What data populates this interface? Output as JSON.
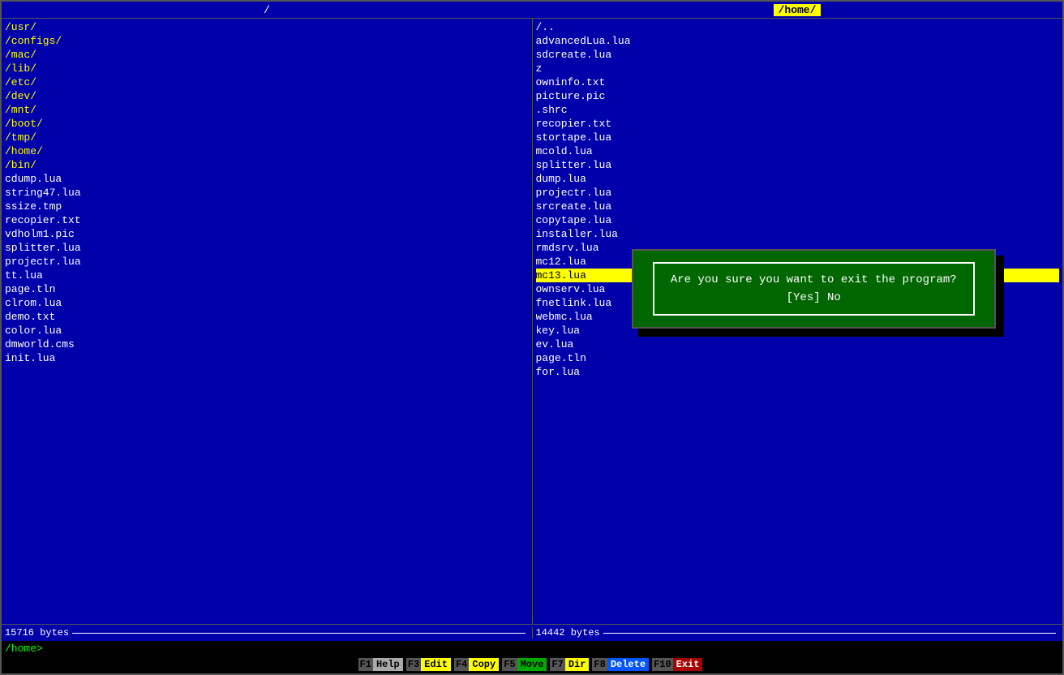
{
  "topbar": {
    "left_path": "/",
    "right_path": "/home/"
  },
  "left_panel": {
    "files": [
      {
        "name": "/usr/",
        "type": "directory"
      },
      {
        "name": "/configs/",
        "type": "directory"
      },
      {
        "name": "/mac/",
        "type": "directory"
      },
      {
        "name": "/lib/",
        "type": "directory"
      },
      {
        "name": "/etc/",
        "type": "directory"
      },
      {
        "name": "/dev/",
        "type": "directory"
      },
      {
        "name": "/mnt/",
        "type": "directory"
      },
      {
        "name": "/boot/",
        "type": "directory"
      },
      {
        "name": "/tmp/",
        "type": "directory"
      },
      {
        "name": "/home/",
        "type": "directory"
      },
      {
        "name": "/bin/",
        "type": "directory"
      },
      {
        "name": "cdump.lua",
        "type": "file"
      },
      {
        "name": "string47.lua",
        "type": "file"
      },
      {
        "name": "ssize.tmp",
        "type": "file"
      },
      {
        "name": "recopier.txt",
        "type": "file"
      },
      {
        "name": "vdholm1.pic",
        "type": "file"
      },
      {
        "name": "splitter.lua",
        "type": "file"
      },
      {
        "name": "projectr.lua",
        "type": "file"
      },
      {
        "name": "tt.lua",
        "type": "file"
      },
      {
        "name": "page.tln",
        "type": "file"
      },
      {
        "name": "clrom.lua",
        "type": "file"
      },
      {
        "name": "demo.txt",
        "type": "file"
      },
      {
        "name": "color.lua",
        "type": "file"
      },
      {
        "name": "dmworld.cms",
        "type": "file"
      },
      {
        "name": "init.lua",
        "type": "file"
      }
    ],
    "status": "15716 bytes",
    "path": "/home"
  },
  "right_panel": {
    "files": [
      {
        "name": "/..",
        "type": "file"
      },
      {
        "name": "advancedLua.lua",
        "type": "file"
      },
      {
        "name": "sdcreate.lua",
        "type": "file"
      },
      {
        "name": "z",
        "type": "file"
      },
      {
        "name": "owninfo.txt",
        "type": "file"
      },
      {
        "name": "picture.pic",
        "type": "file"
      },
      {
        "name": ".shrc",
        "type": "file"
      },
      {
        "name": "recopier.txt",
        "type": "file"
      },
      {
        "name": "stortape.lua",
        "type": "file"
      },
      {
        "name": "mcold.lua",
        "type": "file"
      },
      {
        "name": "splitter.lua",
        "type": "file"
      },
      {
        "name": "dump.lua",
        "type": "file"
      },
      {
        "name": "projectr.lua",
        "type": "file"
      },
      {
        "name": "srcreate.lua",
        "type": "file"
      },
      {
        "name": "copytape.lua",
        "type": "file"
      },
      {
        "name": "installer.lua",
        "type": "file"
      },
      {
        "name": "rmdsrv.lua",
        "type": "file"
      },
      {
        "name": "mc12.lua",
        "type": "file"
      },
      {
        "name": "mc13.lua",
        "type": "file",
        "selected": true
      },
      {
        "name": "ownserv.lua",
        "type": "file"
      },
      {
        "name": "fnetlink.lua",
        "type": "file"
      },
      {
        "name": "webmc.lua",
        "type": "file"
      },
      {
        "name": "",
        "type": "blank"
      },
      {
        "name": "key.lua",
        "type": "file"
      },
      {
        "name": "ev.lua",
        "type": "file"
      },
      {
        "name": "page.tln",
        "type": "file"
      },
      {
        "name": "for.lua",
        "type": "file"
      }
    ],
    "status": "14442 bytes"
  },
  "dialog": {
    "message": "Are you sure you want to exit the program?",
    "options": "[Yes] No"
  },
  "path_bar": {
    "text": "/home>"
  },
  "fn_keys": [
    {
      "num": "F1",
      "label": "Help",
      "color": "gray"
    },
    {
      "num": "F3",
      "label": "Edit",
      "color": "yellow"
    },
    {
      "num": "F4",
      "label": "Copy",
      "color": "yellow"
    },
    {
      "num": "F5",
      "label": "Move",
      "color": "green"
    },
    {
      "num": "F7",
      "label": "Dir",
      "color": "yellow"
    },
    {
      "num": "F8",
      "label": "Delete",
      "color": "blue"
    },
    {
      "num": "F10",
      "label": "Exit",
      "color": "red"
    }
  ]
}
